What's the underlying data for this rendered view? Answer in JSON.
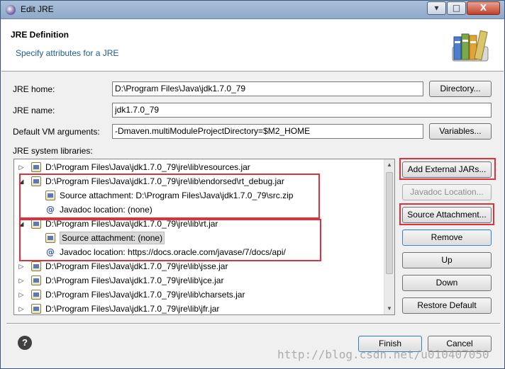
{
  "window": {
    "title": "Edit JRE",
    "help_glyph": "▾",
    "max_glyph": "□",
    "close_glyph": "X"
  },
  "header": {
    "title": "JRE Definition",
    "subtitle": "Specify attributes for a JRE"
  },
  "form": {
    "jre_home_label": "JRE home:",
    "jre_home_value": "D:\\Program Files\\Java\\jdk1.7.0_79",
    "directory_button": "Directory...",
    "jre_name_label": "JRE name:",
    "jre_name_value": "jdk1.7.0_79",
    "vm_args_label": "Default VM arguments:",
    "vm_args_value": "-Dmaven.multiModuleProjectDirectory=$M2_HOME",
    "variables_button": "Variables...",
    "libraries_label": "JRE system libraries:"
  },
  "libraries": [
    {
      "kind": "jar",
      "level": 0,
      "expander": "plus",
      "text": "D:\\Program Files\\Java\\jdk1.7.0_79\\jre\\lib\\resources.jar"
    },
    {
      "kind": "jar",
      "level": 0,
      "expander": "minus",
      "text": "D:\\Program Files\\Java\\jdk1.7.0_79\\jre\\lib\\endorsed\\rt_debug.jar"
    },
    {
      "kind": "source",
      "level": 1,
      "text": "Source attachment: D:\\Program Files\\Java\\jdk1.7.0_79\\src.zip"
    },
    {
      "kind": "javadoc",
      "level": 1,
      "text": "Javadoc location: (none)"
    },
    {
      "kind": "jar",
      "level": 0,
      "expander": "minus",
      "text": "D:\\Program Files\\Java\\jdk1.7.0_79\\jre\\lib\\rt.jar"
    },
    {
      "kind": "source",
      "level": 1,
      "selected": true,
      "text": "Source attachment: (none)"
    },
    {
      "kind": "javadoc",
      "level": 1,
      "text": "Javadoc location: https://docs.oracle.com/javase/7/docs/api/"
    },
    {
      "kind": "jar",
      "level": 0,
      "expander": "plus",
      "text": "D:\\Program Files\\Java\\jdk1.7.0_79\\jre\\lib\\jsse.jar"
    },
    {
      "kind": "jar",
      "level": 0,
      "expander": "plus",
      "text": "D:\\Program Files\\Java\\jdk1.7.0_79\\jre\\lib\\jce.jar"
    },
    {
      "kind": "jar",
      "level": 0,
      "expander": "plus",
      "text": "D:\\Program Files\\Java\\jdk1.7.0_79\\jre\\lib\\charsets.jar"
    },
    {
      "kind": "jar",
      "level": 0,
      "expander": "plus",
      "text": "D:\\Program Files\\Java\\jdk1.7.0_79\\jre\\lib\\jfr.jar"
    }
  ],
  "side_buttons": {
    "add_external_jars": "Add External JARs...",
    "javadoc_location": "Javadoc Location...",
    "source_attachment": "Source Attachment...",
    "remove": "Remove",
    "up": "Up",
    "down": "Down",
    "restore_default": "Restore Default"
  },
  "footer": {
    "finish": "Finish",
    "cancel": "Cancel",
    "help_glyph": "?"
  },
  "watermark": "http://blog.csdn.net/u010407050",
  "colors": {
    "highlight_box": "#e0303a",
    "link_blue": "#1f5b8a"
  }
}
